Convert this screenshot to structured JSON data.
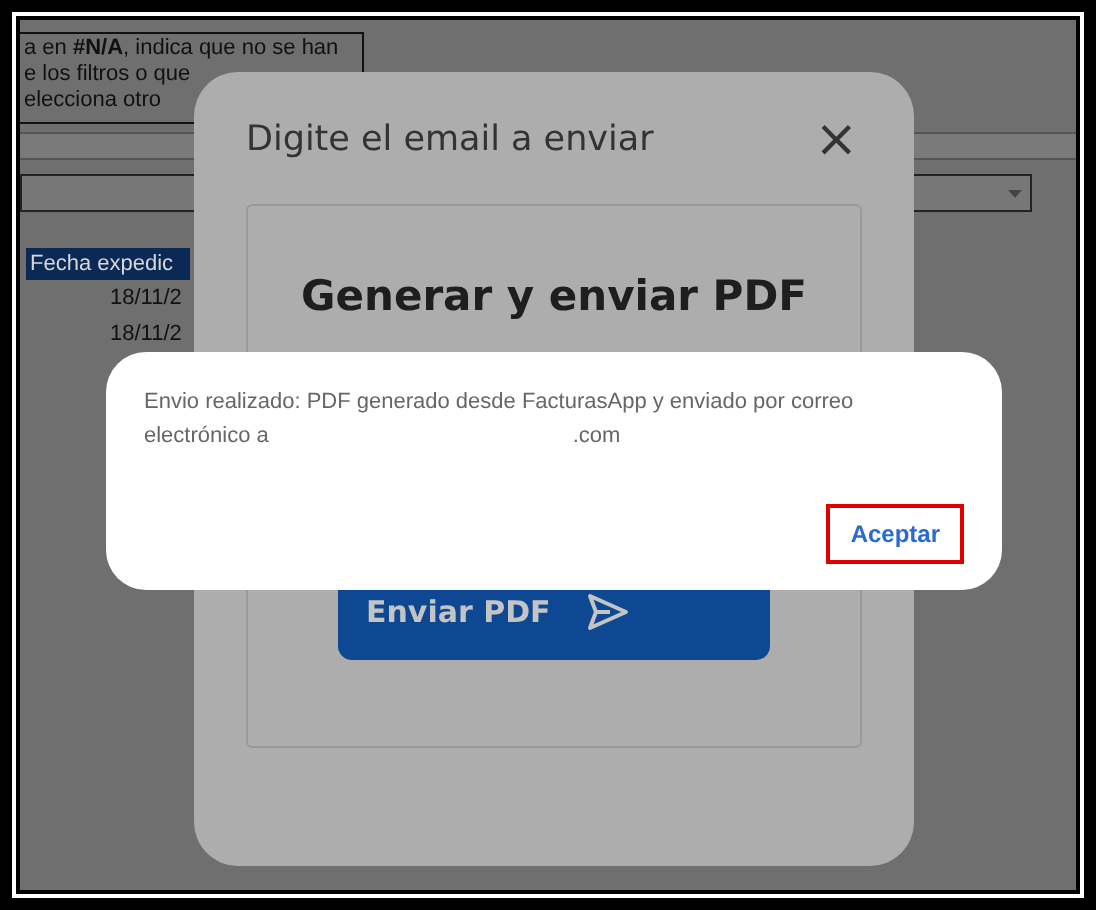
{
  "sheet": {
    "note_lines": [
      "a en **#N/A**, indica que no se han",
      "e los filtros o que",
      "elecciona otro"
    ],
    "column_header": "Fecha expedic",
    "dates": [
      "18/11/2",
      "18/11/2"
    ]
  },
  "dialog": {
    "title": "Digite el email a enviar",
    "close": "×",
    "heading": "Generar y enviar PDF",
    "button": "Enviar PDF"
  },
  "alert": {
    "message_lines": [
      "Envio realizado: PDF generado desde FacturasApp y enviado por correo",
      "electrónico a"
    ],
    "email_suffix": ".com",
    "button": {
      "label": "Aceptar",
      "highlighted": true
    }
  }
}
